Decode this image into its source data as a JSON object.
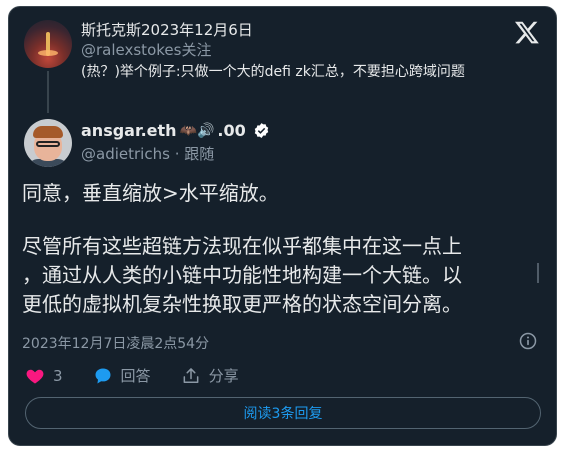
{
  "quoted": {
    "name_date": "斯托克斯2023年12月6日",
    "handle": "@ralexstokes",
    "follow": "关注",
    "text": "(热？)举个例子:只做一个大的defi zk汇总，不要担心跨域问题"
  },
  "author": {
    "name": "ansgar.eth",
    "emoji_text": "🦇🔊",
    "suffix": ".00",
    "handle": "@adietrichs",
    "follow": "· 跟随"
  },
  "tweet": {
    "line1": "同意，垂直缩放>水平缩放。",
    "line2": "尽管所有这些超链方法现在似乎都集中在这一点上",
    "line3": "，通过从人类的小链中功能性地构建一个大链。以",
    "line4": "更低的虚拟机复杂性换取更严格的状态空间分离。"
  },
  "timestamp": "2023年12月7日凌晨2点54分",
  "actions": {
    "likes": "3",
    "reply_label": "回答",
    "share_label": "分享"
  },
  "read_replies": "阅读3条回复",
  "colors": {
    "background": "#15202b",
    "like": "#f91880",
    "reply": "#1d9bf0",
    "verified": "#ffffff"
  },
  "icons": [
    "x-logo-icon",
    "verified-icon",
    "info-icon",
    "heart-icon",
    "reply-bubble-icon",
    "share-icon"
  ]
}
